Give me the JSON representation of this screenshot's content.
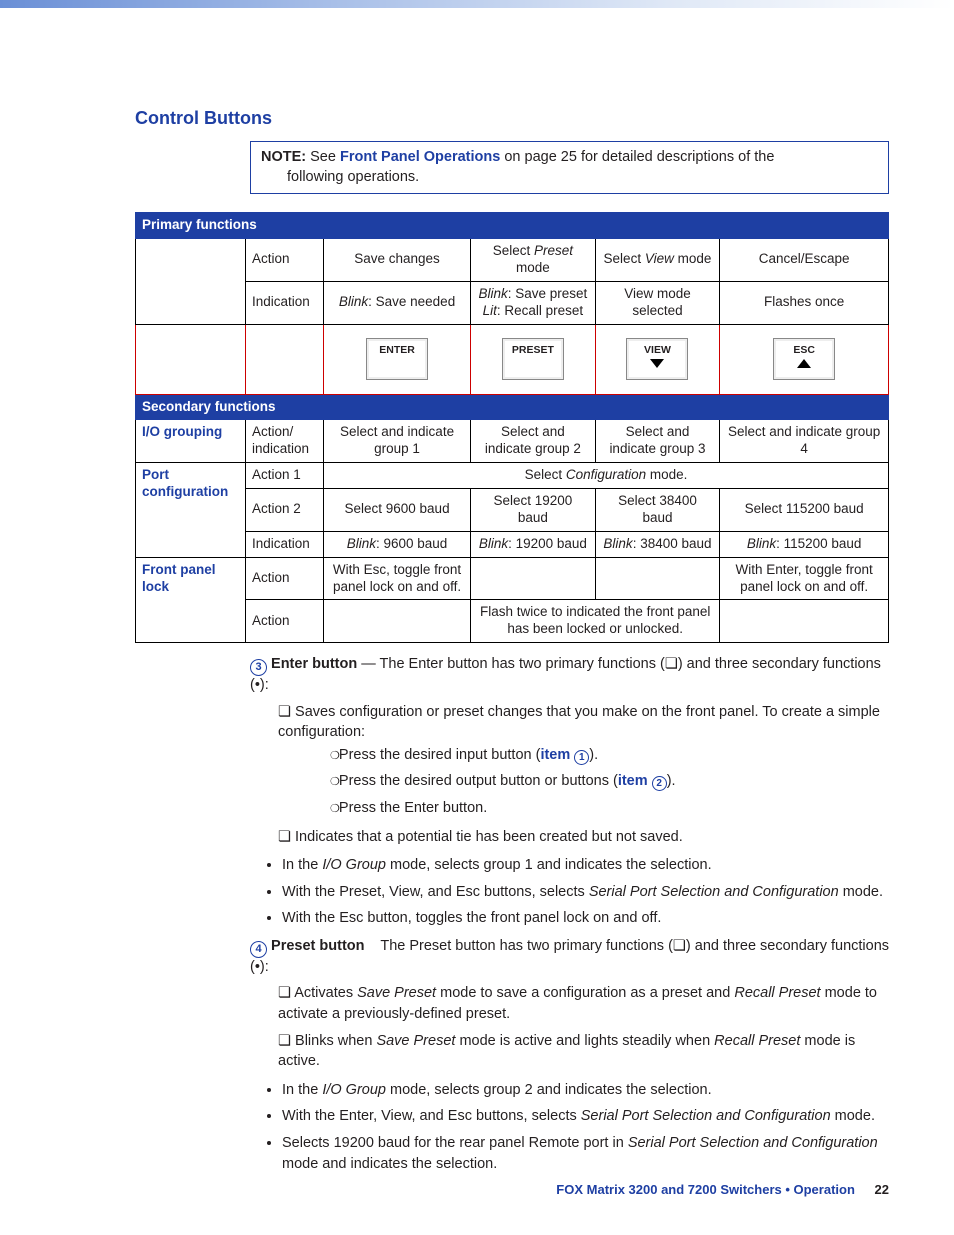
{
  "heading": "Control Buttons",
  "note": {
    "label": "NOTE:",
    "pre": "See ",
    "link": "Front Panel Operations",
    "post": " on page 25 for detailed descriptions of the",
    "line2": "following operations."
  },
  "table": {
    "primary_header": "Primary functions",
    "secondary_header": "Secondary functions",
    "row_action_label": "Action",
    "row_indication_label": "Indication",
    "row_action_indication_label": "Action/ indication",
    "row_action1_label": "Action 1",
    "row_action2_label": "Action 2",
    "cat_io": "I/O grouping",
    "cat_port": "Port configuration",
    "cat_lock": "Front panel lock",
    "primary_action": [
      "Save changes",
      "Select Preset mode",
      "Select View mode",
      "Cancel/Escape"
    ],
    "primary_ind": {
      "c1": "Blink: Save needed",
      "c2a": "Blink: Save preset",
      "c2b": "Lit: Recall preset",
      "c3": "View mode selected",
      "c4": "Flashes once"
    },
    "buttons": [
      "ENTER",
      "PRESET",
      "VIEW",
      "ESC"
    ],
    "io_groups": [
      "Select and indicate group 1",
      "Select and indicate group 2",
      "Select and indicate group 3",
      "Select and indicate group 4"
    ],
    "port_action1": "Select Configuration mode.",
    "port_action2": [
      "Select 9600 baud",
      "Select 19200 baud",
      "Select 38400 baud",
      "Select 115200 baud"
    ],
    "port_ind": [
      "Blink: 9600 baud",
      "Blink: 19200 baud",
      "Blink: 38400 baud",
      "Blink: 115200 baud"
    ],
    "lock_row1": {
      "c1": "With Esc, toggle front panel lock on and off.",
      "c4": "With Enter, toggle front panel lock on and off."
    },
    "lock_row2": "Flash twice to indicated the front panel has been locked or unlocked."
  },
  "enter_section": {
    "num": "3",
    "title": "Enter button",
    "dash": "— The Enter button has two primary functions (❏) and three secondary functions (•):",
    "sq1": "Saves configuration or preset changes that you make on the front panel. To create a simple configuration:",
    "circ1a": "Press the desired input button (",
    "circ1_link": "item",
    "circ1_num": "1",
    "circ1b": ").",
    "circ2a": "Press the desired output button or buttons (",
    "circ2_link": "item",
    "circ2_num": "2",
    "circ2b": ").",
    "circ3": "Press the Enter button.",
    "sq2": "Indicates that a potential tie has been created but not saved.",
    "dot1a": "In the ",
    "dot1_it": "I/O Group",
    "dot1b": " mode, selects group 1 and indicates the selection.",
    "dot2a": "With the Preset, View, and Esc buttons, selects ",
    "dot2_it": "Serial Port Selection and Configuration",
    "dot2b": " mode.",
    "dot3": "With the Esc button, toggles the front panel lock on and off."
  },
  "preset_section": {
    "num": "4",
    "title": "Preset button",
    "dash": "The Preset button has two primary functions (❏) and three secondary functions (•):",
    "sq1a": "Activates ",
    "sq1_it1": "Save Preset",
    "sq1b": " mode to save a configuration as a preset and ",
    "sq1_it2": "Recall Preset",
    "sq1c": " mode to activate a previously-defined preset.",
    "sq2a": "Blinks when ",
    "sq2_it1": "Save Preset",
    "sq2b": " mode is active and lights steadily when ",
    "sq2_it2": "Recall Preset",
    "sq2c": " mode is active.",
    "dot1a": "In the ",
    "dot1_it": "I/O Group",
    "dot1b": " mode, selects group 2 and indicates the selection.",
    "dot2a": "With the Enter, View, and Esc buttons, selects ",
    "dot2_it": "Serial Port Selection and Configuration",
    "dot2b": " mode.",
    "dot3a": "Selects 19200 baud for the rear panel Remote port in ",
    "dot3_it": "Serial Port Selection and Configuration",
    "dot3b": " mode and indicates the selection."
  },
  "footer": {
    "product": "FOX Matrix 3200 and 7200 Switchers • Operation",
    "page": "22"
  }
}
